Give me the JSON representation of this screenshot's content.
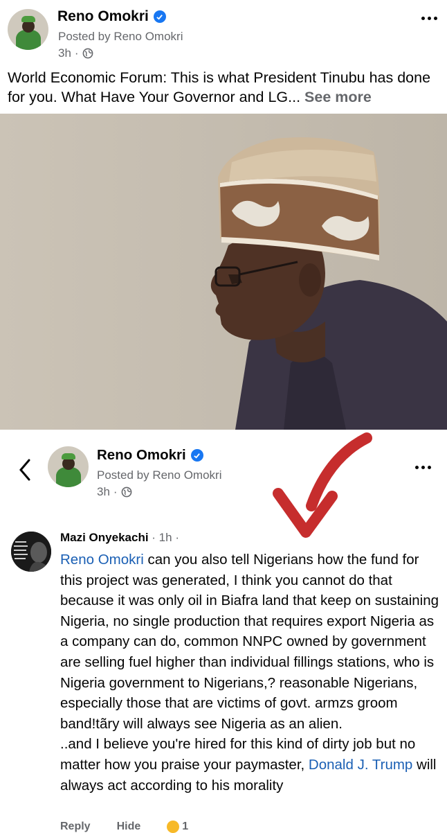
{
  "post": {
    "author": "Reno Omokri",
    "posted_by": "Posted by Reno Omokri",
    "time": "3h",
    "time_sep": "·",
    "caption": "World Economic Forum: This is what President Tinubu has done for you. What Have Your Governor and LG...",
    "see_more": "See more"
  },
  "quoted_header": {
    "author": "Reno Omokri",
    "posted_by": "Posted by Reno Omokri",
    "time": "3h",
    "time_sep": "·"
  },
  "comment": {
    "author": "Mazi Onyekachi",
    "time": "· 1h ·",
    "mention": "Reno Omokri",
    "text_main": " can you also tell Nigerians how the fund for this project was generated, I think you cannot do that because it was only oil in Biafra land that keep on sustaining Nigeria, no single production that requires export Nigeria as a company can do, common NNPC owned by government are selling fuel higher than individual fillings stations, who is Nigeria government to Nigerians,?  reasonable Nigerians, especially those that are victims of govt. armzs groom band!tãry will always see Nigeria as an alien.",
    "text_second": "..and I believe you're hired for this kind of dirty job but no matter how you praise your paymaster, ",
    "mention2": "Donald J. Trump",
    "text_end": "  will always act according to his morality",
    "actions": [
      "Reply",
      "Hide"
    ],
    "reaction_count": "1"
  },
  "colors": {
    "verified": "#1877f2",
    "link": "#1a5fb4",
    "secondary_text": "#65676b",
    "arrow": "#c62d2d"
  },
  "icons": [
    "verified-badge-icon",
    "globe-icon",
    "more-options-icon",
    "back-chevron-icon",
    "laugh-reaction-icon",
    "like-icon",
    "comment-icon"
  ]
}
